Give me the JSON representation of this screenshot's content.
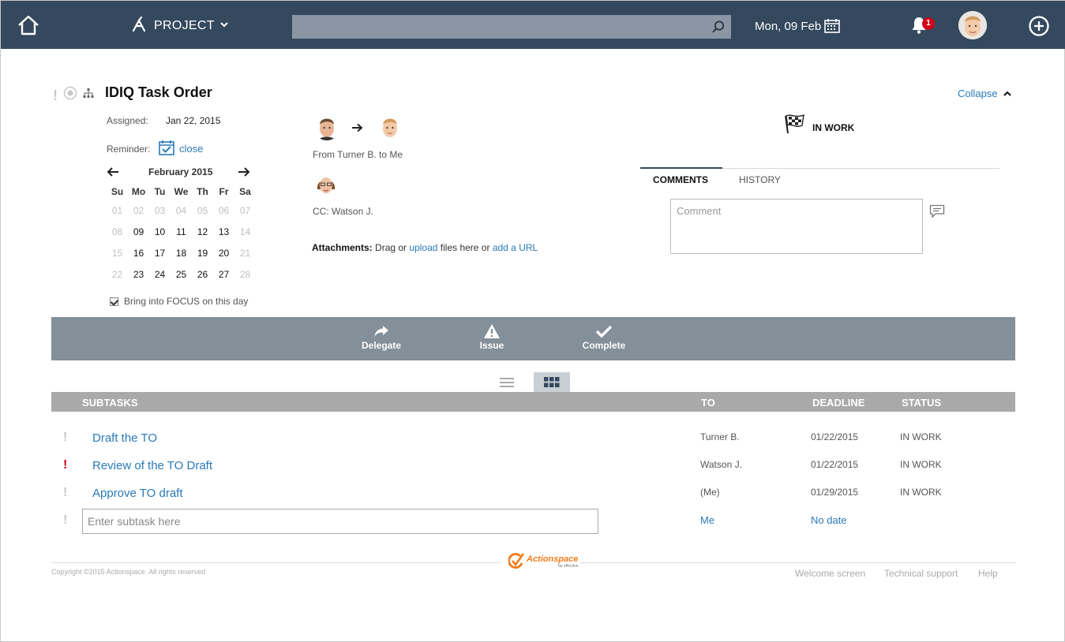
{
  "topbar": {
    "project_label": "PROJECT",
    "search_placeholder": "",
    "date_label": "Mon, 09 Feb",
    "notifications_count": "1",
    "bg_color": "#34495e"
  },
  "task": {
    "title": "IDIQ Task Order",
    "collapse_label": "Collapse",
    "assigned_label": "Assigned:",
    "assigned_value": "Jan 22, 2015",
    "reminder_label": "Reminder:",
    "reminder_close": "close",
    "from_text": "From Turner B. to Me",
    "cc_text": "CC: Watson J.",
    "attachments_label": "Attachments:",
    "attach_text_1": "Drag or",
    "attach_link_upload": "upload",
    "attach_text_2": "files here or",
    "attach_link_url": "add a URL",
    "status": "IN WORK"
  },
  "calendar": {
    "month": "February 2015",
    "weekdays": [
      "Su",
      "Mo",
      "Tu",
      "We",
      "Th",
      "Fr",
      "Sa"
    ],
    "weeks": [
      [
        "01",
        "02",
        "03",
        "04",
        "05",
        "06",
        "07"
      ],
      [
        "08",
        "09",
        "10",
        "11",
        "12",
        "13",
        "14"
      ],
      [
        "15",
        "16",
        "17",
        "18",
        "19",
        "20",
        "21"
      ],
      [
        "22",
        "23",
        "24",
        "25",
        "26",
        "27",
        "28"
      ]
    ],
    "dim": [
      [
        true,
        true,
        true,
        true,
        true,
        true,
        true
      ],
      [
        true,
        false,
        false,
        false,
        false,
        false,
        true
      ],
      [
        true,
        false,
        false,
        false,
        false,
        false,
        true
      ],
      [
        true,
        false,
        false,
        false,
        false,
        false,
        true
      ]
    ],
    "focus_label": "Bring into FOCUS on this day"
  },
  "comments": {
    "tab_comments": "COMMENTS",
    "tab_history": "HISTORY",
    "placeholder": "Comment"
  },
  "actions": {
    "delegate": "Delegate",
    "issue": "Issue",
    "complete": "Complete"
  },
  "subtasks": {
    "headers": {
      "subtasks": "SUBTASKS",
      "to": "TO",
      "deadline": "DEADLINE",
      "status": "STATUS"
    },
    "rows": [
      {
        "priority": "normal",
        "title": "Draft the TO",
        "to": "Turner B.",
        "deadline": "01/22/2015",
        "status": "IN WORK"
      },
      {
        "priority": "high",
        "title": "Review of the TO Draft",
        "to": "Watson J.",
        "deadline": "01/22/2015",
        "status": "IN WORK"
      },
      {
        "priority": "normal",
        "title": "Approve TO draft",
        "to": "(Me)",
        "deadline": "01/29/2015",
        "status": "IN WORK"
      }
    ],
    "new_placeholder": "Enter subtask here",
    "new_to": "Me",
    "new_deadline": "No date"
  },
  "footer": {
    "copyright": "Copyright ©2015 Actionspace. All rights reserved",
    "logo_text": "Actionspace",
    "logo_tagline": "be effective",
    "links": [
      "Welcome screen",
      "Technical support",
      "Help"
    ]
  }
}
